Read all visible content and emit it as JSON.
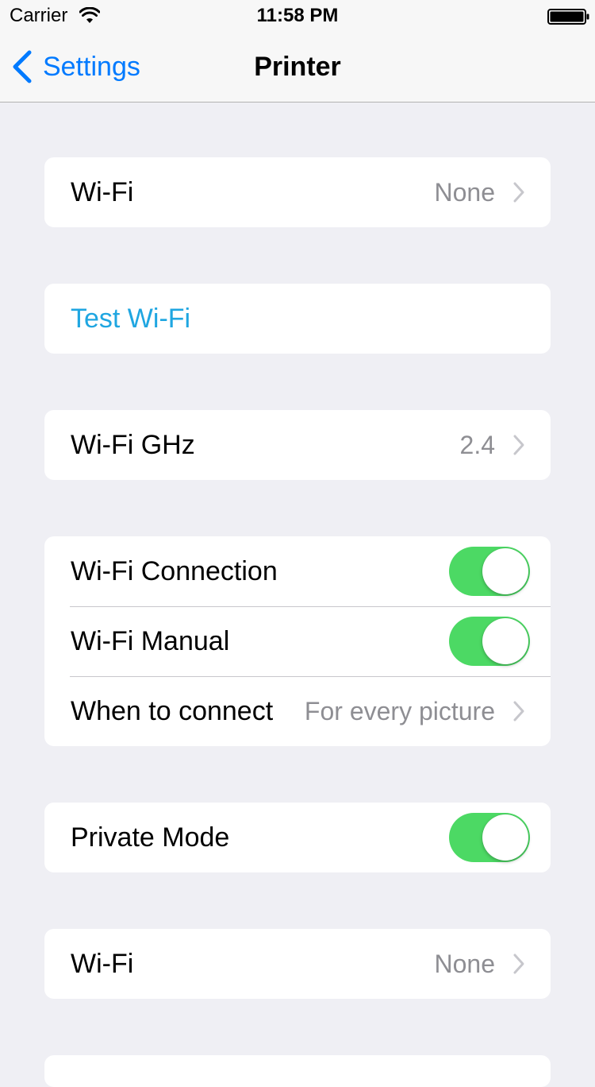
{
  "status_bar": {
    "carrier": "Carrier",
    "time": "11:58 PM",
    "icons": [
      "wifi-icon",
      "battery-icon"
    ]
  },
  "nav": {
    "back_label": "Settings",
    "title": "Printer",
    "icon": "chevron-left-icon"
  },
  "colors": {
    "background": "#efeff4",
    "tint": "#007aff",
    "action_text": "#1fa6e1",
    "toggle_on": "#4cd964",
    "secondary_text": "#8e8e93"
  },
  "groups": [
    {
      "rows": [
        {
          "label": "Wi-Fi",
          "value": "None",
          "accessory": "chevron-right-icon"
        }
      ]
    },
    {
      "rows": [
        {
          "label": "Test Wi-Fi",
          "style": "action"
        }
      ]
    },
    {
      "rows": [
        {
          "label": "Wi-Fi GHz",
          "value": "2.4",
          "accessory": "chevron-right-icon"
        }
      ]
    },
    {
      "rows": [
        {
          "label": "Wi-Fi Connection",
          "toggle": true
        },
        {
          "label": "Wi-Fi Manual",
          "toggle": true
        },
        {
          "label": "When to connect",
          "value": "For every picture",
          "accessory": "chevron-right-icon"
        }
      ]
    },
    {
      "rows": [
        {
          "label": "Private Mode",
          "toggle": true
        }
      ]
    },
    {
      "rows": [
        {
          "label": "Wi-Fi",
          "value": "None",
          "accessory": "chevron-right-icon"
        }
      ]
    }
  ]
}
